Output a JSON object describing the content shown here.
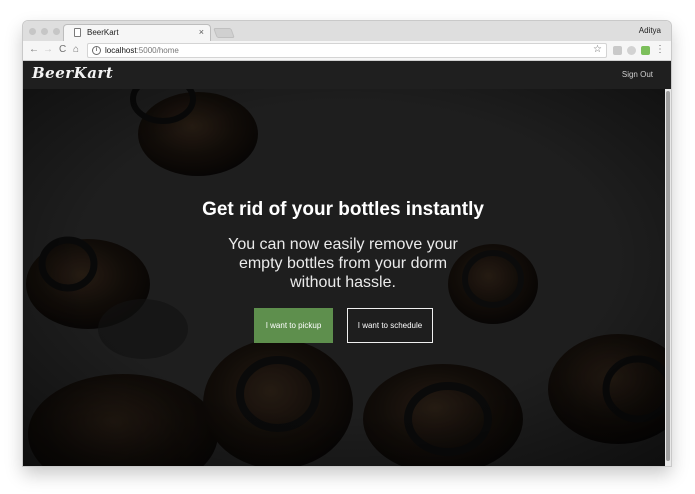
{
  "browser": {
    "tab_title": "BeerKart",
    "tab_close": "×",
    "profile_name": "Aditya",
    "url_host": "localhost",
    "url_rest": ":5000/home",
    "back_glyph": "←",
    "forward_glyph": "→",
    "reload_glyph": "C",
    "home_glyph": "⌂",
    "star_glyph": "☆",
    "info_glyph": "i",
    "menu_glyph": "⋮"
  },
  "site": {
    "brand": "BeerKart",
    "signout_label": "Sign Out"
  },
  "hero": {
    "headline": "Get rid of your bottles instantly",
    "subhead": "You can now easily remove your empty bottles from your dorm without hassle.",
    "pickup_label": "I want to pickup",
    "schedule_label": "I want to schedule"
  },
  "colors": {
    "accent_green": "#5e8f4d",
    "navbar_bg": "#1f1f1f"
  },
  "icons": [
    "document-icon",
    "close-icon",
    "back-arrow-icon",
    "forward-arrow-icon",
    "reload-icon",
    "home-icon",
    "info-icon",
    "star-icon",
    "extension-icon",
    "menu-icon"
  ]
}
